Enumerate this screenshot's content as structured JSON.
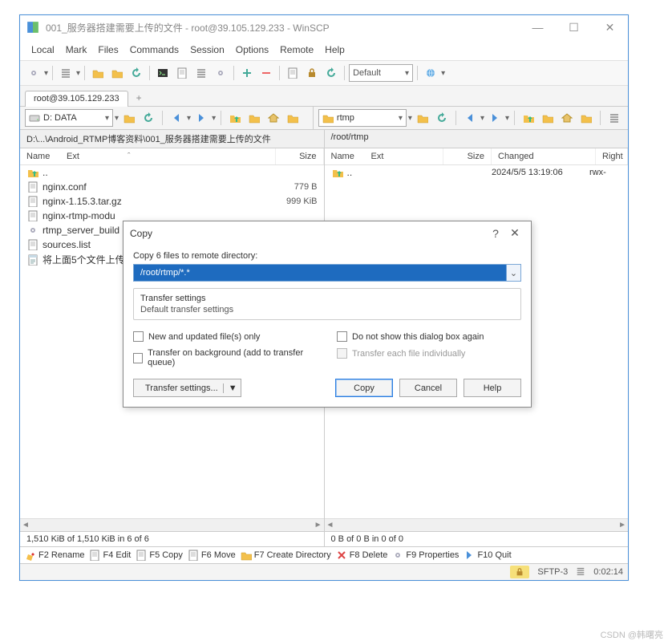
{
  "title": "001_服务器搭建需要上传的文件 - root@39.105.129.233 - WinSCP",
  "menu": [
    "Local",
    "Mark",
    "Files",
    "Commands",
    "Session",
    "Options",
    "Remote",
    "Help"
  ],
  "toolbar": {
    "default_label": "Default"
  },
  "session": {
    "tab0": "root@39.105.129.233",
    "add": "+"
  },
  "local": {
    "drive": "D: DATA",
    "path": "D:\\...\\Android_RTMP博客资料\\001_服务器搭建需要上传的文件",
    "cols": {
      "name": "Name",
      "ext": "Ext",
      "size": "Size"
    },
    "files": [
      {
        "name": "..",
        "size": "",
        "icon": "up"
      },
      {
        "name": "nginx.conf",
        "size": "779 B",
        "icon": "file"
      },
      {
        "name": "nginx-1.15.3.tar.gz",
        "size": "999 KiB",
        "icon": "file"
      },
      {
        "name": "nginx-rtmp-modu",
        "size": "",
        "icon": "file"
      },
      {
        "name": "rtmp_server_build",
        "size": "",
        "icon": "gear"
      },
      {
        "name": "sources.list",
        "size": "",
        "icon": "file"
      },
      {
        "name": "将上面5个文件上传",
        "size": "",
        "icon": "notes"
      }
    ],
    "status": "1,510 KiB of 1,510 KiB in 6 of 6"
  },
  "remote": {
    "drive": "rtmp",
    "path": "/root/rtmp",
    "cols": {
      "name": "Name",
      "ext": "Ext",
      "size": "Size",
      "changed": "Changed",
      "rights": "Right"
    },
    "files": [
      {
        "name": "..",
        "size": "",
        "changed": "2024/5/5 13:19:06",
        "rights": "rwx-",
        "icon": "up"
      }
    ],
    "status": "0 B of 0 B in 0 of 0"
  },
  "fkeys": {
    "f2": "F2 Rename",
    "f4": "F4 Edit",
    "f5": "F5 Copy",
    "f6": "F6 Move",
    "f7": "F7 Create Directory",
    "f8": "F8 Delete",
    "f9": "F9 Properties",
    "f10": "F10 Quit"
  },
  "statusbar": {
    "proto": "SFTP-3",
    "time": "0:02:14"
  },
  "dialog": {
    "title": "Copy",
    "label": "Copy 6 files to remote directory:",
    "path": "/root/rtmp/*.*",
    "group_title": "Transfer settings",
    "group_sub": "Default transfer settings",
    "chk_new": "New and updated file(s) only",
    "chk_bg": "Transfer on background (add to transfer queue)",
    "chk_noshow": "Do not show this dialog box again",
    "chk_indiv": "Transfer each file individually",
    "btn_settings": "Transfer settings...",
    "btn_copy": "Copy",
    "btn_cancel": "Cancel",
    "btn_help": "Help"
  },
  "watermark": "CSDN @韩曙亮"
}
